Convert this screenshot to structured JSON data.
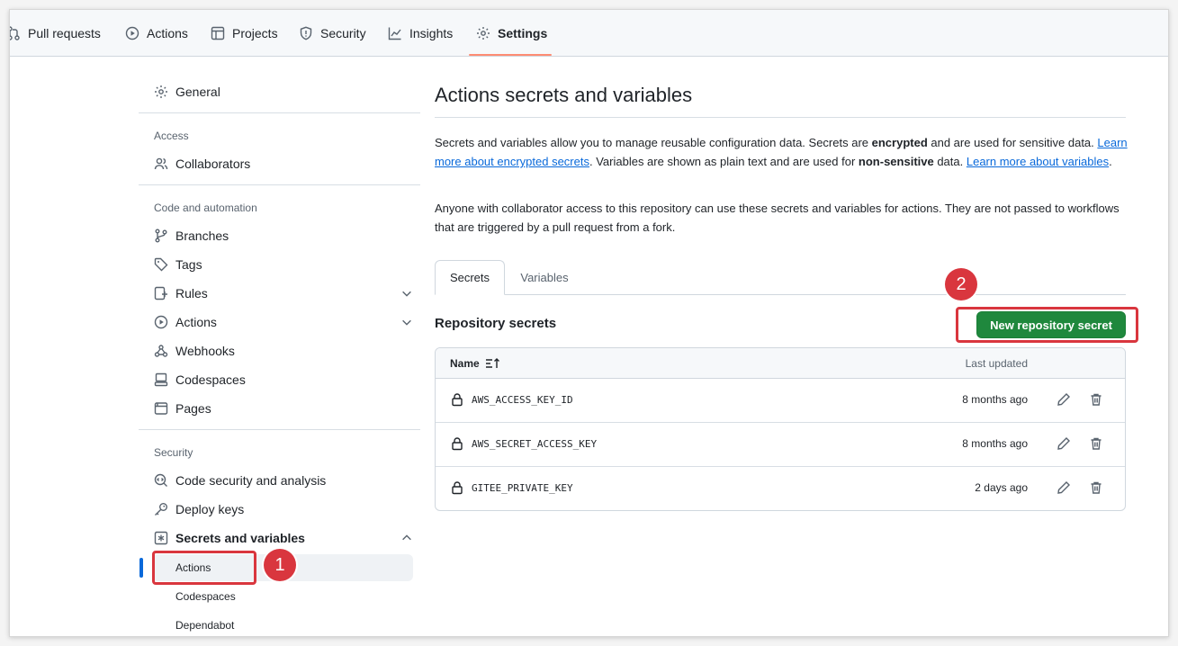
{
  "topnav": {
    "items": [
      {
        "label": "Pull requests",
        "icon": "pull-request-icon"
      },
      {
        "label": "Actions",
        "icon": "play-icon"
      },
      {
        "label": "Projects",
        "icon": "table-icon"
      },
      {
        "label": "Security",
        "icon": "shield-icon"
      },
      {
        "label": "Insights",
        "icon": "graph-icon"
      },
      {
        "label": "Settings",
        "icon": "gear-icon",
        "active": true
      }
    ]
  },
  "sidebar": {
    "general": "General",
    "access_heading": "Access",
    "collaborators": "Collaborators",
    "code_heading": "Code and automation",
    "branches": "Branches",
    "tags": "Tags",
    "rules": "Rules",
    "actions": "Actions",
    "webhooks": "Webhooks",
    "codespaces": "Codespaces",
    "pages": "Pages",
    "security_heading": "Security",
    "code_security": "Code security and analysis",
    "deploy_keys": "Deploy keys",
    "secrets_vars": "Secrets and variables",
    "sub_actions": "Actions",
    "sub_codespaces": "Codespaces",
    "sub_dependabot": "Dependabot"
  },
  "main": {
    "title": "Actions secrets and variables",
    "para1": {
      "t1": "Secrets and variables allow you to manage reusable configuration data. Secrets are ",
      "b1": "encrypted",
      "t2": " and are used for sensitive data. ",
      "link1": "Learn more about encrypted secrets",
      "t3": ". Variables are shown as plain text and are used for ",
      "b2": "non-sensitive",
      "t4": " data. ",
      "link2": "Learn more about variables",
      "t5": "."
    },
    "para2": "Anyone with collaborator access to this repository can use these secrets and variables for actions. They are not passed to workflows that are triggered by a pull request from a fork.",
    "tabs": {
      "secrets": "Secrets",
      "variables": "Variables"
    },
    "section_title": "Repository secrets",
    "new_button": "New repository secret",
    "table": {
      "col_name": "Name",
      "col_updated": "Last updated",
      "rows": [
        {
          "name": "AWS_ACCESS_KEY_ID",
          "updated": "8 months ago"
        },
        {
          "name": "AWS_SECRET_ACCESS_KEY",
          "updated": "8 months ago"
        },
        {
          "name": "GITEE_PRIVATE_KEY",
          "updated": "2 days ago"
        }
      ]
    }
  },
  "annotations": {
    "step1": "1",
    "step2": "2"
  },
  "colors": {
    "primary_button": "#1f883d",
    "highlight": "#d9363e",
    "link": "#0969da",
    "nav_underline": "#fd8c73"
  }
}
